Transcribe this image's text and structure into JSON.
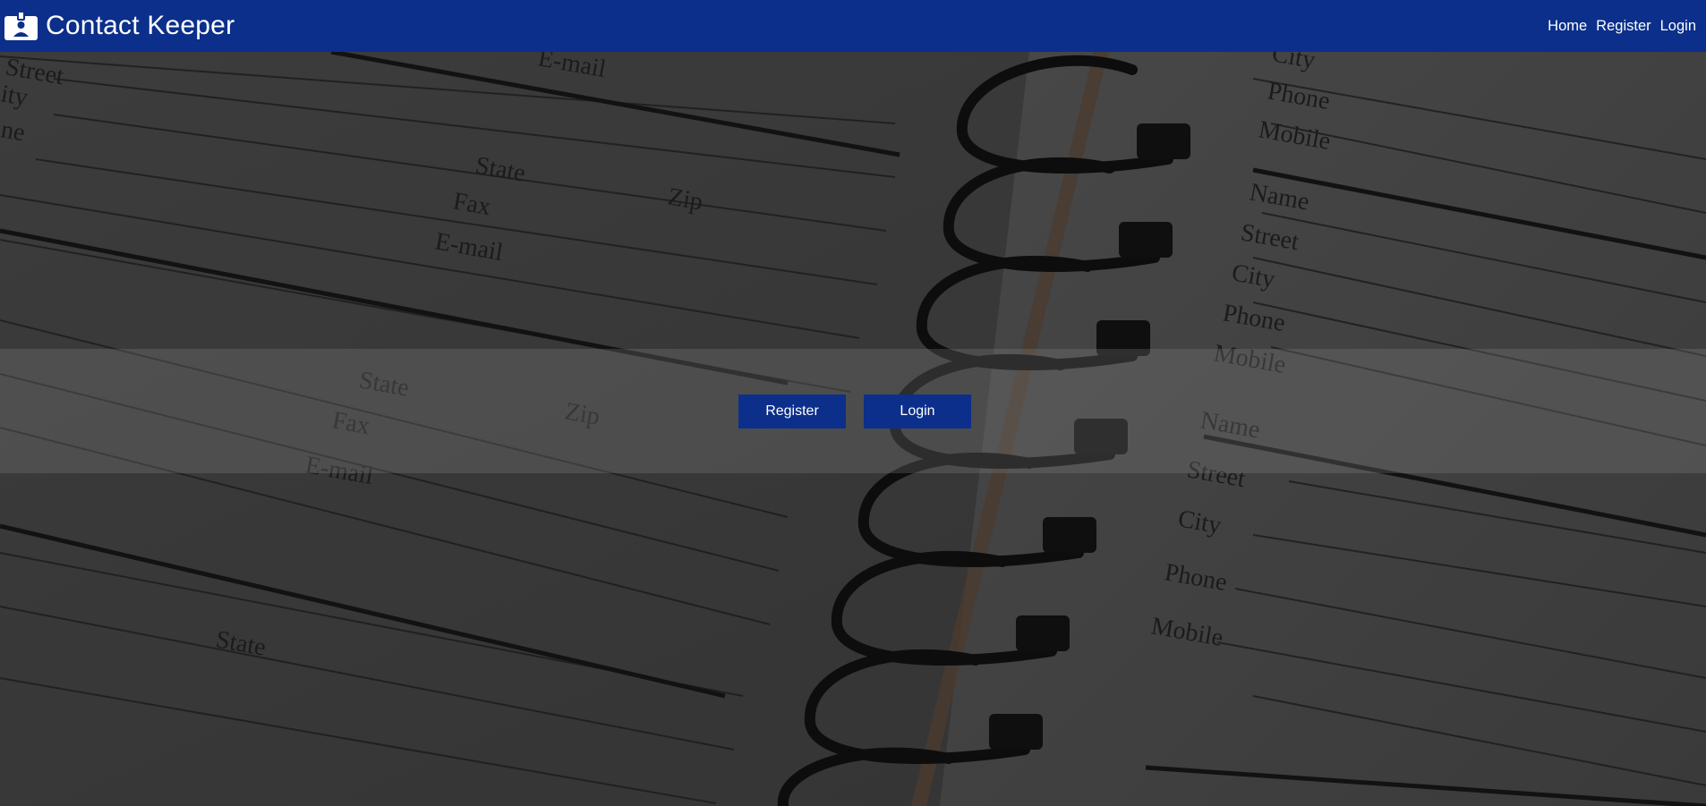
{
  "app": {
    "title": "Contact Keeper",
    "icon": "id-badge-icon"
  },
  "nav": {
    "home": "Home",
    "register": "Register",
    "login": "Login"
  },
  "hero": {
    "register_button": "Register",
    "login_button": "Login"
  },
  "background_text": {
    "name": "Name",
    "street": "Street",
    "city": "City",
    "state": "State",
    "zip": "Zip",
    "phone": "Phone",
    "fax": "Fax",
    "email": "E-mail",
    "mobile": "Mobile",
    "street_partial": "Street",
    "city_partial": "ity",
    "phone_partial": "ne"
  },
  "colors": {
    "primary": "#0b2f8a",
    "text_light": "#ffffff",
    "overlay": "#2f2f2f"
  }
}
